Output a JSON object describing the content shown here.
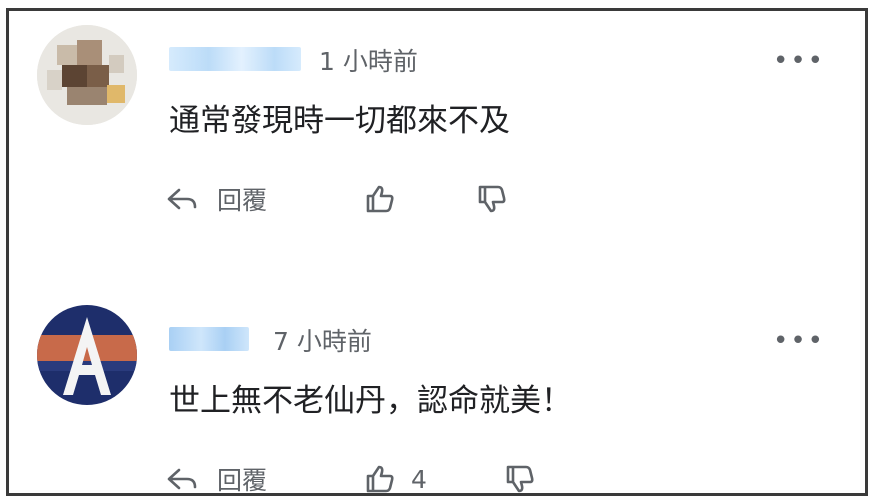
{
  "comments": [
    {
      "time": "1 小時前",
      "text": "通常發現時一切都來不及",
      "reply_label": "回覆",
      "like_count": "",
      "more_label": "•••"
    },
    {
      "time": "7 小時前",
      "text": "世上無不老仙丹，認命就美！",
      "reply_label": "回覆",
      "like_count": "4",
      "more_label": "•••",
      "avatar_letter": "A"
    }
  ],
  "colors": {
    "text": "#202124",
    "muted": "#5f6368",
    "username_blur": "#cfe6fb",
    "avatar_a_bg": "#1e2e6b",
    "avatar_a_stripe": "#c86a4a"
  }
}
